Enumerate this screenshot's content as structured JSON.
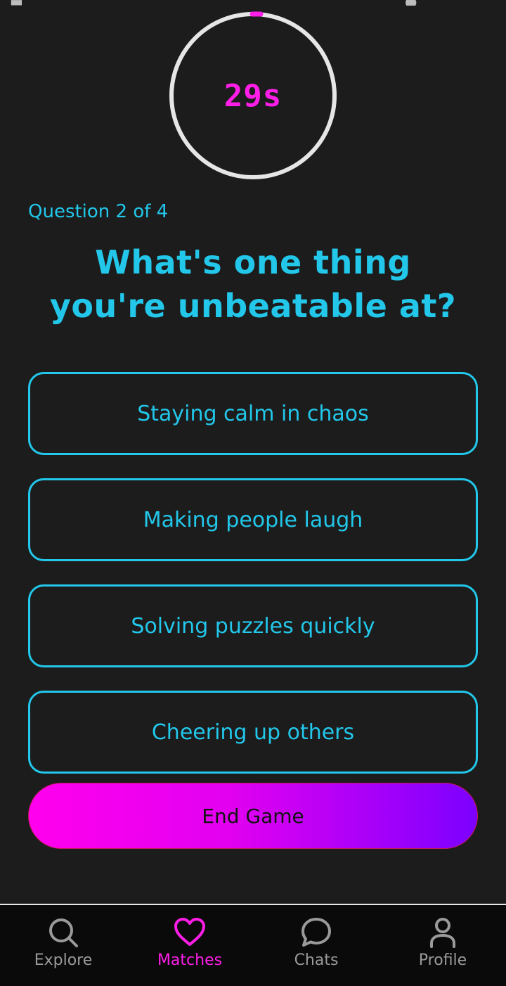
{
  "colors": {
    "background": "#1c1c1c",
    "accent_cyan": "#22c7ea",
    "accent_magenta": "#ff1ee8",
    "button_gradient_start": "#ff00ee",
    "button_gradient_end": "#7c00ff",
    "nav_inactive": "#9a9a9a"
  },
  "timer": {
    "label": "29s",
    "remaining_fraction": 0.967,
    "ring_color": "#e6e6e6",
    "indicator_color": "#ff1ee8"
  },
  "question": {
    "counter": "Question 2 of 4",
    "line1": "What's one thing",
    "line2": "you're unbeatable at?"
  },
  "options": [
    {
      "label": "Staying calm in chaos"
    },
    {
      "label": "Making people laugh"
    },
    {
      "label": "Solving puzzles quickly"
    },
    {
      "label": "Cheering up others"
    }
  ],
  "end_button": {
    "label": "End Game"
  },
  "bottom_nav": {
    "items": [
      {
        "label": "Explore",
        "icon": "search-icon",
        "active": false
      },
      {
        "label": "Matches",
        "icon": "heart-icon",
        "active": true
      },
      {
        "label": "Chats",
        "icon": "chat-bubble-icon",
        "active": false
      },
      {
        "label": "Profile",
        "icon": "person-icon",
        "active": false
      }
    ]
  }
}
